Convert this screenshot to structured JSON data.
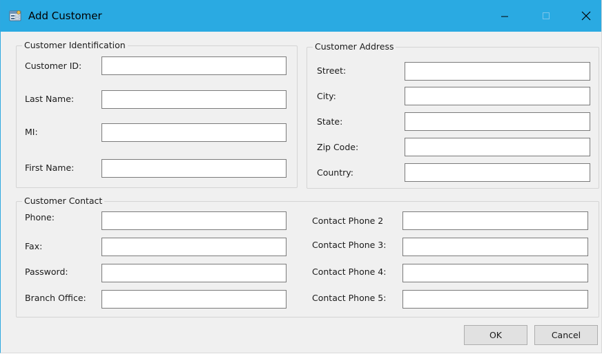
{
  "window": {
    "title": "Add Customer",
    "icons": {
      "app": "app-form-icon",
      "minimize": "minimize-icon",
      "maximize": "maximize-icon",
      "close": "close-icon"
    }
  },
  "identification": {
    "title": "Customer Identification",
    "fields": [
      {
        "label": "Customer ID:",
        "value": ""
      },
      {
        "label": "Last Name:",
        "value": ""
      },
      {
        "label": "MI:",
        "value": ""
      },
      {
        "label": "First Name:",
        "value": ""
      }
    ]
  },
  "address": {
    "title": "Customer Address",
    "fields": [
      {
        "label": "Street:",
        "value": ""
      },
      {
        "label": "City:",
        "value": ""
      },
      {
        "label": "State:",
        "value": ""
      },
      {
        "label": "Zip Code:",
        "value": ""
      },
      {
        "label": "Country:",
        "value": ""
      }
    ]
  },
  "contact": {
    "title": "Customer Contact",
    "left_fields": [
      {
        "label": "Phone:",
        "value": ""
      },
      {
        "label": "Fax:",
        "value": ""
      },
      {
        "label": "Password:",
        "value": ""
      },
      {
        "label": "Branch Office:",
        "value": ""
      }
    ],
    "right_fields": [
      {
        "label": "Contact Phone 2",
        "value": ""
      },
      {
        "label": "Contact Phone 3:",
        "value": ""
      },
      {
        "label": "Contact Phone 4:",
        "value": ""
      },
      {
        "label": "Contact Phone 5:",
        "value": ""
      }
    ]
  },
  "buttons": {
    "ok": "OK",
    "cancel": "Cancel"
  },
  "colors": {
    "titlebar": "#2aaae2",
    "window_bg": "#f0f0f0",
    "border": "#d4d4d4"
  }
}
